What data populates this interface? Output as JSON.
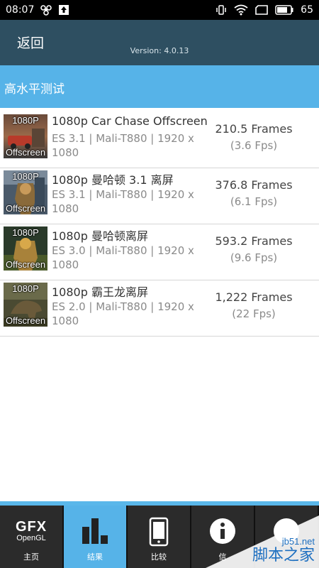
{
  "status_bar": {
    "time": "08:07",
    "battery": "65",
    "icons": [
      "pinwheel-icon",
      "upload-icon",
      "vibrate-icon",
      "wifi-icon",
      "screen-icon",
      "battery-icon"
    ]
  },
  "header": {
    "back_label": "返回",
    "version": "Version: 4.0.13"
  },
  "section": {
    "title": "高水平测试"
  },
  "results": [
    {
      "thumb_top": "1080P",
      "thumb_bottom": "Offscreen",
      "title": "1080p Car Chase Offscreen",
      "subtitle": "ES 3.1 | Mali-T880 | 1920 x 1080",
      "frames": "210.5 Frames",
      "fps": "(3.6 Fps)"
    },
    {
      "thumb_top": "1080P",
      "thumb_bottom": "Offscreen",
      "title": "1080p 曼哈顿 3.1 离屏",
      "subtitle": "ES 3.1 | Mali-T880 | 1920 x 1080",
      "frames": "376.8 Frames",
      "fps": "(6.1 Fps)"
    },
    {
      "thumb_top": "1080P",
      "thumb_bottom": "Offscreen",
      "title": "1080p 曼哈顿离屏",
      "subtitle": "ES 3.0 | Mali-T880 | 1920 x 1080",
      "frames": "593.2 Frames",
      "fps": "(9.6 Fps)"
    },
    {
      "thumb_top": "1080P",
      "thumb_bottom": "Offscreen",
      "title": "1080p 霸王龙离屏",
      "subtitle": "ES 2.0 | Mali-T880 | 1920 x 1080",
      "frames": "1,222 Frames",
      "fps": "(22 Fps)"
    }
  ],
  "bottom_nav": {
    "home": {
      "logo_main": "GFX",
      "logo_sub": "OpenGL",
      "label": "主页"
    },
    "results": {
      "label": "结果",
      "icon": "bar-chart-icon"
    },
    "compare": {
      "label": "比较",
      "icon": "phone-icon"
    },
    "info": {
      "label": "信",
      "icon": "info-icon"
    },
    "more": {
      "label": "",
      "icon": "more-icon"
    }
  },
  "watermark": {
    "url": "jb51.net",
    "name": "脚本之家"
  },
  "colors": {
    "status_bar": "#000000",
    "header": "#2e4f61",
    "section_bar": "#56b3e8",
    "nav_active": "#56b3e8",
    "nav_bg": "#2b2b2b"
  }
}
